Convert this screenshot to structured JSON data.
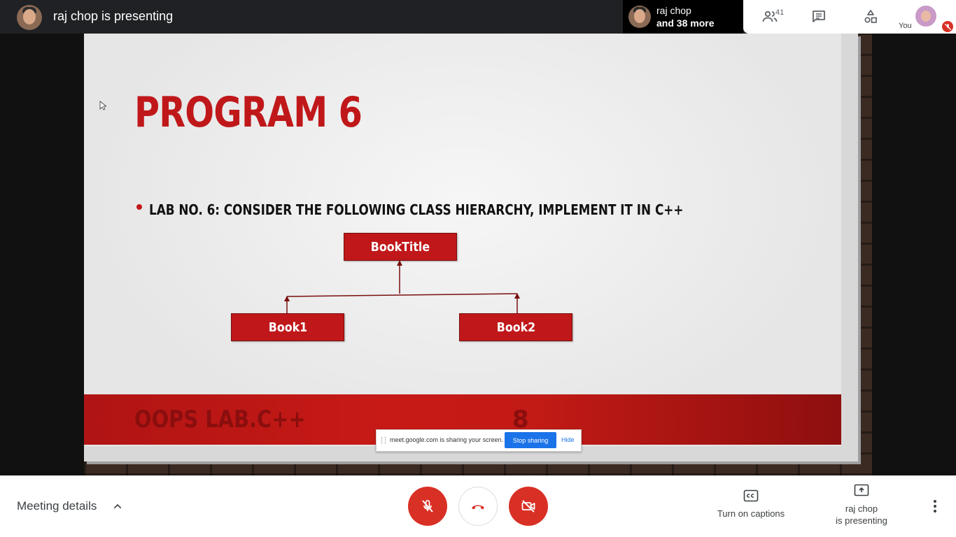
{
  "topbar": {
    "presenting_title": "raj chop is presenting",
    "participant_name": "raj chop",
    "participant_more": "and 38 more",
    "people_count": "41",
    "you_label": "You"
  },
  "slide": {
    "title": "PROGRAM 6",
    "bullet": "LAB NO. 6: CONSIDER THE FOLLOWING CLASS HIERARCHY, IMPLEMENT IT IN C++",
    "root_node": "BookTitle",
    "child_nodes": [
      "Book1",
      "Book2"
    ],
    "footer_text": "OOPS LAB.C++",
    "slide_number": "8"
  },
  "share_bar": {
    "message": "meet.google.com is sharing your screen.",
    "stop_label": "Stop sharing",
    "hide_label": "Hide"
  },
  "bottombar": {
    "meeting_details": "Meeting details",
    "captions_label": "Turn on captions",
    "presenting_line1": "raj chop",
    "presenting_line2": "is presenting"
  },
  "colors": {
    "slide_red": "#c0181a",
    "danger_red": "#d93025",
    "accent_blue": "#1a73e8"
  },
  "icons": [
    "people-icon",
    "chat-icon",
    "activities-icon",
    "mic-off-icon",
    "call-end-icon",
    "videocam-off-icon",
    "closed-caption-icon",
    "present-screen-icon",
    "more-vert-icon",
    "chevron-up-icon"
  ]
}
